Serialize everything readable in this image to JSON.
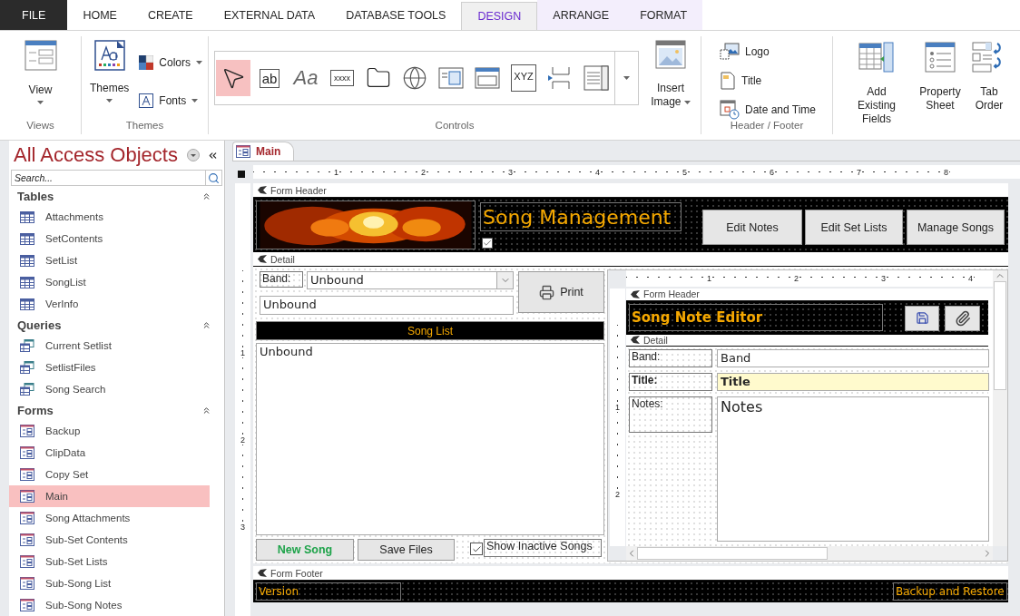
{
  "ribbon_tabs": [
    {
      "label": "FILE",
      "kind": "file",
      "selected": false
    },
    {
      "label": "HOME",
      "kind": "main",
      "selected": false
    },
    {
      "label": "CREATE",
      "kind": "main",
      "selected": false
    },
    {
      "label": "EXTERNAL DATA",
      "kind": "main",
      "selected": false
    },
    {
      "label": "DATABASE TOOLS",
      "kind": "main",
      "selected": false
    },
    {
      "label": "DESIGN",
      "kind": "contextual",
      "selected": true
    },
    {
      "label": "ARRANGE",
      "kind": "contextual",
      "selected": false
    },
    {
      "label": "FORMAT",
      "kind": "contextual",
      "selected": false
    }
  ],
  "ribbon": {
    "views": {
      "button": "View",
      "label": "Views"
    },
    "themes": {
      "button": "Themes",
      "colors": "Colors",
      "fonts": "Fonts",
      "label": "Themes"
    },
    "controls": {
      "label": "Controls",
      "insert_image": "Insert Image",
      "tools": [
        {
          "kind": "pointer",
          "selected": true
        },
        {
          "kind": "textbox",
          "text": "ab",
          "selected": false
        },
        {
          "kind": "label",
          "text": "Aa",
          "selected": false
        },
        {
          "kind": "button",
          "text": "xxxx",
          "selected": false
        },
        {
          "kind": "tab",
          "selected": false
        },
        {
          "kind": "hyperlink",
          "selected": false
        },
        {
          "kind": "browser",
          "selected": false
        },
        {
          "kind": "navigation",
          "selected": false
        },
        {
          "kind": "group",
          "text": "XYZ",
          "selected": false
        },
        {
          "kind": "pagebreak",
          "selected": false
        },
        {
          "kind": "combo",
          "selected": false
        }
      ]
    },
    "header_footer": {
      "label": "Header / Footer",
      "items": [
        {
          "kind": "logo",
          "label": "Logo"
        },
        {
          "kind": "title",
          "label": "Title"
        },
        {
          "kind": "datetime",
          "label": "Date and Time"
        }
      ]
    },
    "tools": [
      {
        "kind": "fields",
        "label": "Add Existing Fields"
      },
      {
        "kind": "sheet",
        "label": "Property Sheet"
      },
      {
        "kind": "order",
        "label": "Tab Order"
      }
    ]
  },
  "nav": {
    "title": "All Access Objects",
    "search": {
      "placeholder": "Search..."
    },
    "groups": [
      {
        "name": "Tables",
        "kind": "table",
        "items": [
          {
            "label": "Attachments",
            "selected": false
          },
          {
            "label": "SetContents",
            "selected": false
          },
          {
            "label": "SetList",
            "selected": false
          },
          {
            "label": "SongList",
            "selected": false
          },
          {
            "label": "VerInfo",
            "selected": false
          }
        ]
      },
      {
        "name": "Queries",
        "kind": "query",
        "items": [
          {
            "label": "Current Setlist",
            "selected": false
          },
          {
            "label": "SetlistFiles",
            "selected": false
          },
          {
            "label": "Song Search",
            "selected": false
          }
        ]
      },
      {
        "name": "Forms",
        "kind": "form",
        "items": [
          {
            "label": "Backup",
            "selected": false
          },
          {
            "label": "ClipData",
            "selected": false
          },
          {
            "label": "Copy Set",
            "selected": false
          },
          {
            "label": "Main",
            "selected": true
          },
          {
            "label": "Song Attachments",
            "selected": false
          },
          {
            "label": "Sub-Set Contents",
            "selected": false
          },
          {
            "label": "Sub-Set Lists",
            "selected": false
          },
          {
            "label": "Sub-Song List",
            "selected": false
          },
          {
            "label": "Sub-Song Notes",
            "selected": false
          }
        ]
      }
    ]
  },
  "document_tab": {
    "label": "Main",
    "selected": true
  },
  "ruler": [
    "1",
    "2",
    "3",
    "4",
    "5",
    "6",
    "7",
    "8"
  ],
  "vertical_ruler": [
    "1",
    "2",
    "3"
  ],
  "form": {
    "header_label": "Form Header",
    "title": "Song Management",
    "title_checkbox": {
      "checked": true
    },
    "header_buttons": [
      "Edit Notes",
      "Edit Set Lists",
      "Manage Songs"
    ],
    "detail_label": "Detail",
    "band_label": "Band:",
    "band_combo": "Unbound",
    "unbound_field": "Unbound",
    "print_button": "Print",
    "song_list_label": "Song List",
    "song_list_value": "Unbound",
    "new_song_button": "New Song",
    "save_files_button": "Save Files",
    "show_inactive": {
      "label": "Show Inactive Songs",
      "checked": true
    },
    "subform": {
      "ruler": [
        "1",
        "2",
        "3",
        "4"
      ],
      "vertical_ruler": [
        "1",
        "2"
      ],
      "header_label": "Form Header",
      "title": "Song Note Editor",
      "detail_label": "Detail",
      "fields": [
        {
          "label": "Band:",
          "value": "Band",
          "kind": "text"
        },
        {
          "label": "Title:",
          "value": "Title",
          "kind": "highlight"
        },
        {
          "label": "Notes:",
          "value": "Notes",
          "kind": "memo"
        }
      ]
    },
    "footer_label": "Form Footer",
    "version": "Version",
    "backup_restore": "Backup and Restore"
  }
}
